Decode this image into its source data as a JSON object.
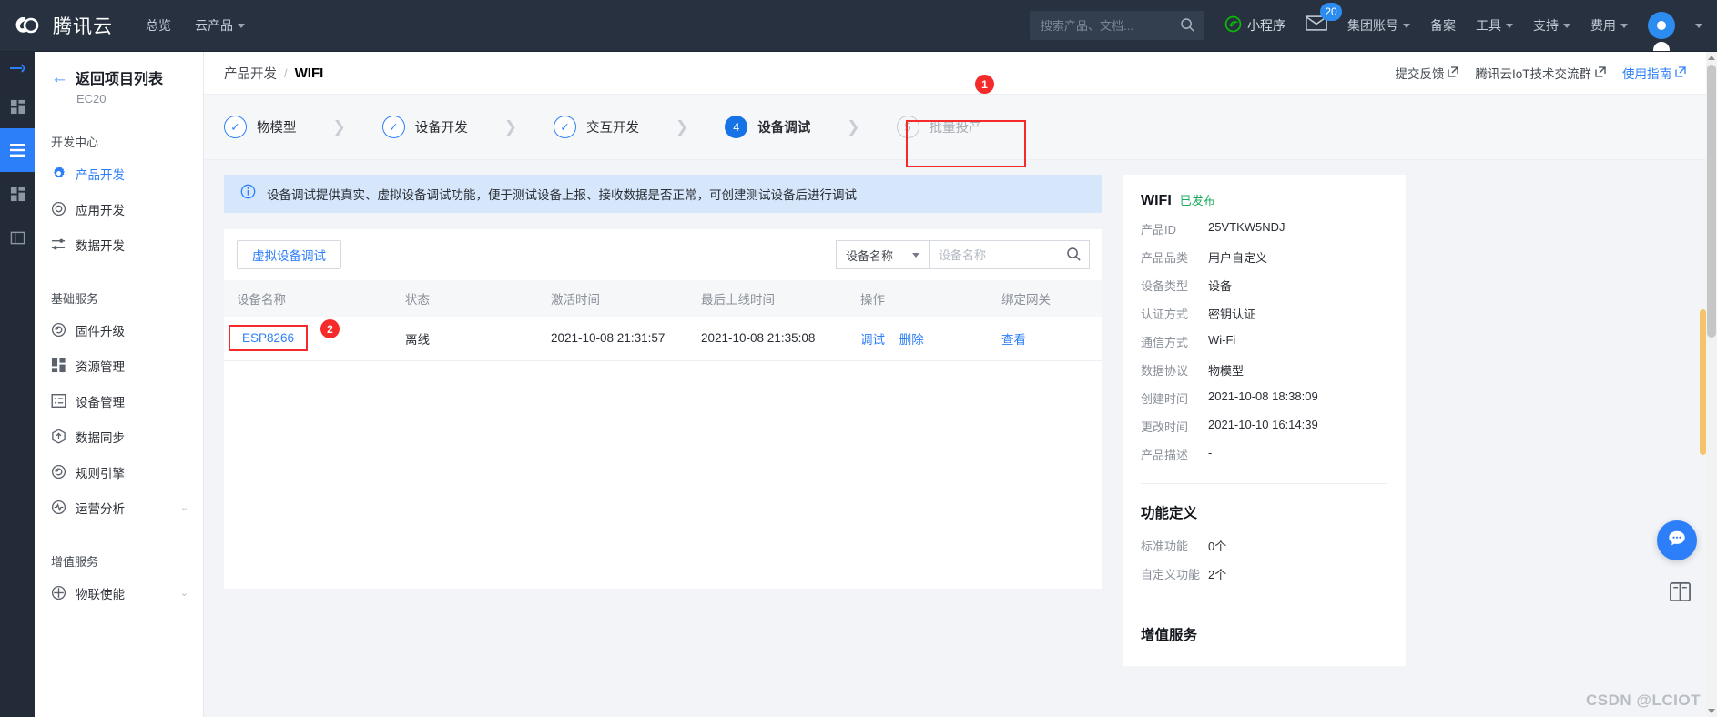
{
  "topnav": {
    "brand": "腾讯云",
    "links": [
      {
        "label": "总览",
        "caret": false
      },
      {
        "label": "云产品",
        "caret": true
      }
    ],
    "search_placeholder": "搜索产品、文档...",
    "mini_program": "小程序",
    "mail_badge": "20",
    "right_links": [
      {
        "label": "集团账号",
        "caret": true
      },
      {
        "label": "备案",
        "caret": false
      },
      {
        "label": "工具",
        "caret": true
      },
      {
        "label": "支持",
        "caret": true
      },
      {
        "label": "费用",
        "caret": true
      }
    ]
  },
  "sidebar": {
    "back_label": "返回项目列表",
    "project": "EC20",
    "groups": [
      {
        "title": "开发中心",
        "items": [
          {
            "label": "产品开发",
            "icon": "gear-icon",
            "active": true,
            "chevron": false
          },
          {
            "label": "应用开发",
            "icon": "target-icon",
            "active": false,
            "chevron": false
          },
          {
            "label": "数据开发",
            "icon": "sliders-icon",
            "active": false,
            "chevron": false
          }
        ]
      },
      {
        "title": "基础服务",
        "items": [
          {
            "label": "固件升级",
            "icon": "refresh-circle-icon",
            "active": false,
            "chevron": false
          },
          {
            "label": "资源管理",
            "icon": "dashboard-icon",
            "active": false,
            "chevron": false
          },
          {
            "label": "设备管理",
            "icon": "list-box-icon",
            "active": false,
            "chevron": false
          },
          {
            "label": "数据同步",
            "icon": "upload-hex-icon",
            "active": false,
            "chevron": false
          },
          {
            "label": "规则引擎",
            "icon": "refresh-circle-icon",
            "active": false,
            "chevron": false
          },
          {
            "label": "运营分析",
            "icon": "pulse-circle-icon",
            "active": false,
            "chevron": true
          }
        ]
      },
      {
        "title": "增值服务",
        "items": [
          {
            "label": "物联使能",
            "icon": "plus-circle-icon",
            "active": false,
            "chevron": true
          }
        ]
      }
    ]
  },
  "breadcrumb": {
    "parent": "产品开发",
    "separator": "/",
    "current": "WIFI",
    "right_links": [
      {
        "label": "提交反馈",
        "blue": false
      },
      {
        "label": "腾讯云IoT技术交流群",
        "blue": false
      },
      {
        "label": "使用指南",
        "blue": true
      }
    ]
  },
  "steps": [
    {
      "num": "1",
      "label": "物模型",
      "state": "done"
    },
    {
      "num": "2",
      "label": "设备开发",
      "state": "done"
    },
    {
      "num": "3",
      "label": "交互开发",
      "state": "done"
    },
    {
      "num": "4",
      "label": "设备调试",
      "state": "current"
    },
    {
      "num": "5",
      "label": "批量投产",
      "state": "todo"
    }
  ],
  "annotations": [
    {
      "id": "1",
      "label": "1"
    },
    {
      "id": "2",
      "label": "2"
    }
  ],
  "alert": {
    "text": "设备调试提供真实、虚拟设备调试功能，便于测试设备上报、接收数据是否正常，可创建测试设备后进行调试"
  },
  "toolbar": {
    "virtual_debug_button": "虚拟设备调试",
    "filter_select_value": "设备名称",
    "filter_input_value": "",
    "filter_input_placeholder": "设备名称"
  },
  "table": {
    "columns": [
      "设备名称",
      "状态",
      "激活时间",
      "最后上线时间",
      "操作",
      "绑定网关"
    ],
    "rows": [
      {
        "name": "ESP8266",
        "status": "离线",
        "activate_time": "2021-10-08 21:31:57",
        "last_online_time": "2021-10-08 21:35:08",
        "actions": [
          "调试",
          "删除"
        ],
        "gateway": "查看"
      }
    ]
  },
  "detail_card": {
    "title": "WIFI",
    "status": "已发布",
    "fields": [
      {
        "key": "产品ID",
        "value": "25VTKW5NDJ"
      },
      {
        "key": "产品品类",
        "value": "用户自定义"
      },
      {
        "key": "设备类型",
        "value": "设备"
      },
      {
        "key": "认证方式",
        "value": "密钥认证"
      },
      {
        "key": "通信方式",
        "value": "Wi-Fi"
      },
      {
        "key": "数据协议",
        "value": "物模型"
      },
      {
        "key": "创建时间",
        "value": "2021-10-08 18:38:09"
      },
      {
        "key": "更改时间",
        "value": "2021-10-10 16:14:39"
      },
      {
        "key": "产品描述",
        "value": "-"
      }
    ],
    "function_section": {
      "title": "功能定义",
      "fields": [
        {
          "key": "标准功能",
          "value": "0个"
        },
        {
          "key": "自定义功能",
          "value": "2个"
        }
      ]
    },
    "value_added_title": "增值服务"
  },
  "floating": {
    "chat_icon": "chat-bubble-icon",
    "book_icon": "book-icon"
  },
  "watermark": "CSDN @LCIOT"
}
